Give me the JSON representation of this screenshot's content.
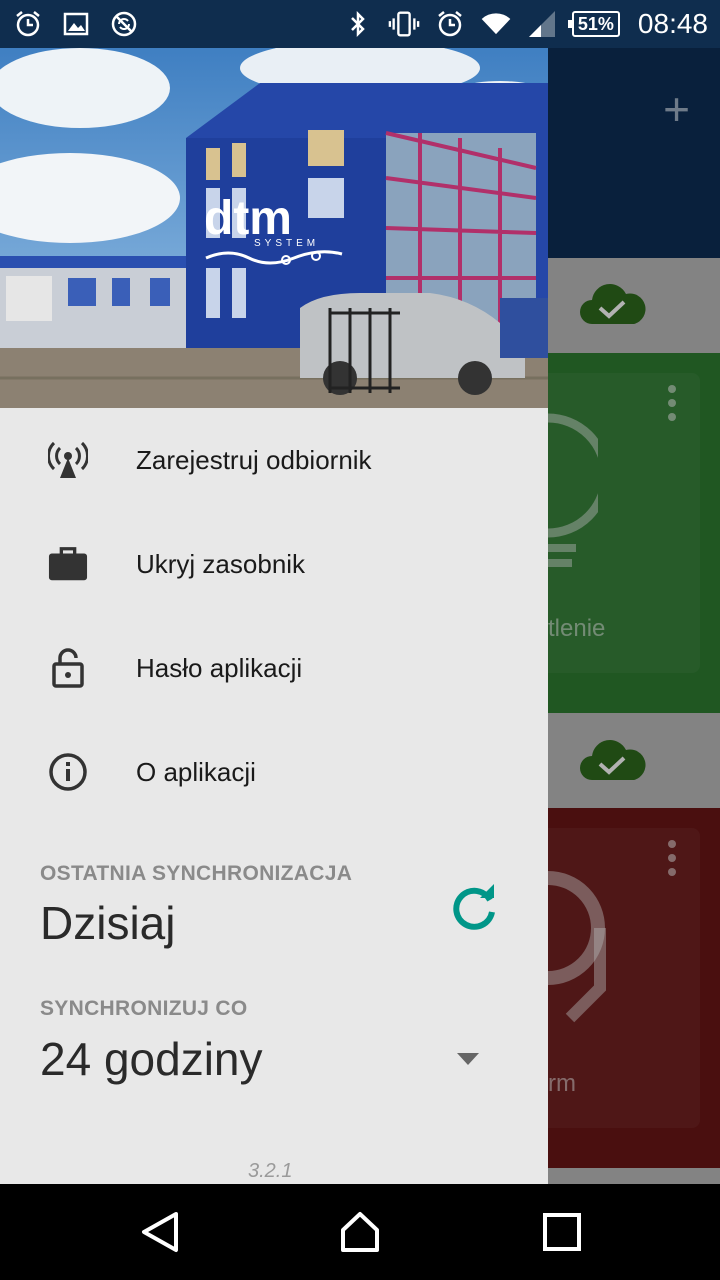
{
  "status_bar": {
    "left_icons": [
      "alarm-icon",
      "image-icon",
      "no-sync-icon"
    ],
    "right_icons": [
      "bluetooth-icon",
      "vibrate-icon",
      "alarm-icon",
      "wifi-icon",
      "signal-icon"
    ],
    "battery": "51%",
    "time": "08:48"
  },
  "background_app": {
    "add_label": "+",
    "card1_label": "tlenie",
    "card2_label": "rm"
  },
  "drawer": {
    "menu": [
      {
        "label": "Zarejestruj odbiornik",
        "icon": "antenna-icon"
      },
      {
        "label": "Ukryj zasobnik",
        "icon": "briefcase-icon"
      },
      {
        "label": "Hasło aplikacji",
        "icon": "lock-icon"
      },
      {
        "label": "O aplikacji",
        "icon": "info-icon"
      }
    ],
    "last_sync_label": "OSTATNIA SYNCHRONIZACJA",
    "last_sync_value": "Dzisiaj",
    "sync_every_label": "SYNCHRONIZUJ CO",
    "sync_every_value": "24 godziny",
    "version": "3.2.1"
  },
  "colors": {
    "accent": "#009688",
    "appbar": "#0d2f57",
    "green_card": "#2e7d32",
    "red_card": "#8b1a1a"
  }
}
